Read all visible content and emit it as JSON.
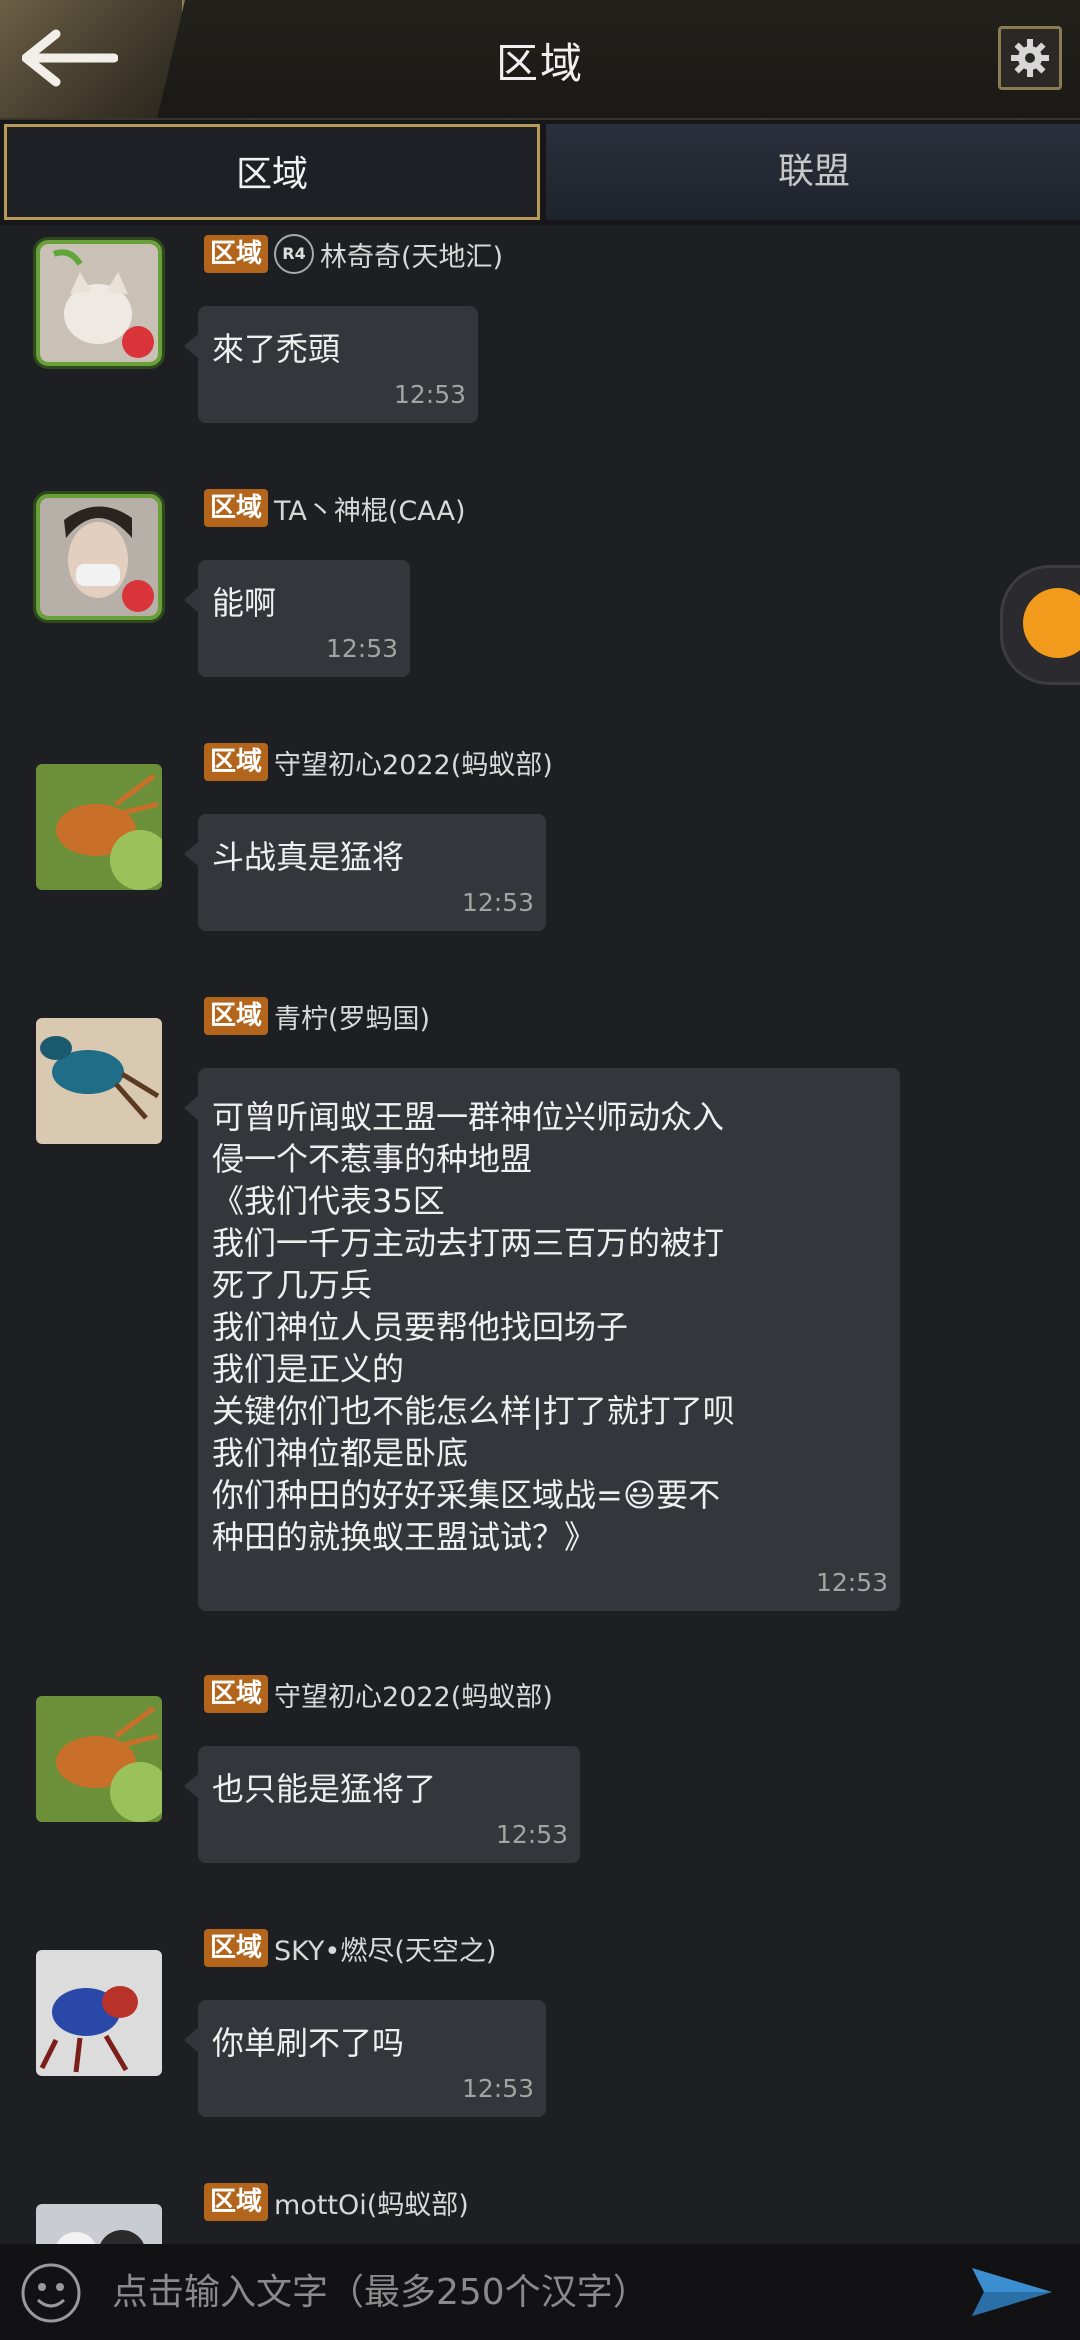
{
  "header": {
    "title": "区域"
  },
  "tabs": [
    {
      "label": "区域",
      "active": true
    },
    {
      "label": "联盟",
      "active": false
    }
  ],
  "region_badge": "区域",
  "messages": [
    {
      "sender": "林奇奇(天地汇)",
      "rank": "R4",
      "text": "來了禿頭",
      "time": "12:53"
    },
    {
      "sender": "TA丶神棍(CAA)",
      "text": "能啊",
      "time": "12:53"
    },
    {
      "sender": "守望初心2022(蚂蚁部)",
      "text": "斗战真是猛将",
      "time": "12:53"
    },
    {
      "sender": "青柠(罗蚂国)",
      "text": "可曾听闻蚁王盟一群神位兴师动众入\n侵一个不惹事的种地盟\n《我们代表35区\n我们一千万主动去打两三百万的被打\n死了几万兵\n我们神位人员要帮他找回场子\n我们是正义的\n关键你们也不能怎么样|打了就打了呗\n我们神位都是卧底\n你们种田的好好采集区域战=😃要不\n种田的就换蚁王盟试试？》",
      "time": "12:53"
    },
    {
      "sender": "守望初心2022(蚂蚁部)",
      "text": "也只能是猛将了",
      "time": "12:53"
    },
    {
      "sender": "SKY•燃尽(天空之)",
      "text": "你单刷不了吗",
      "time": "12:53"
    },
    {
      "sender": "mottOi(蚂蚁部)"
    }
  ],
  "input": {
    "placeholder": "点击输入文字（最多250个汉字）"
  },
  "icons": {
    "back": "back-arrow-icon",
    "settings": "gear-icon",
    "emoji": "smiley-icon",
    "send": "send-icon"
  },
  "colors": {
    "accent_gold": "#b89a58",
    "region_badge": "#b3651c",
    "bubble": "#35363b"
  }
}
